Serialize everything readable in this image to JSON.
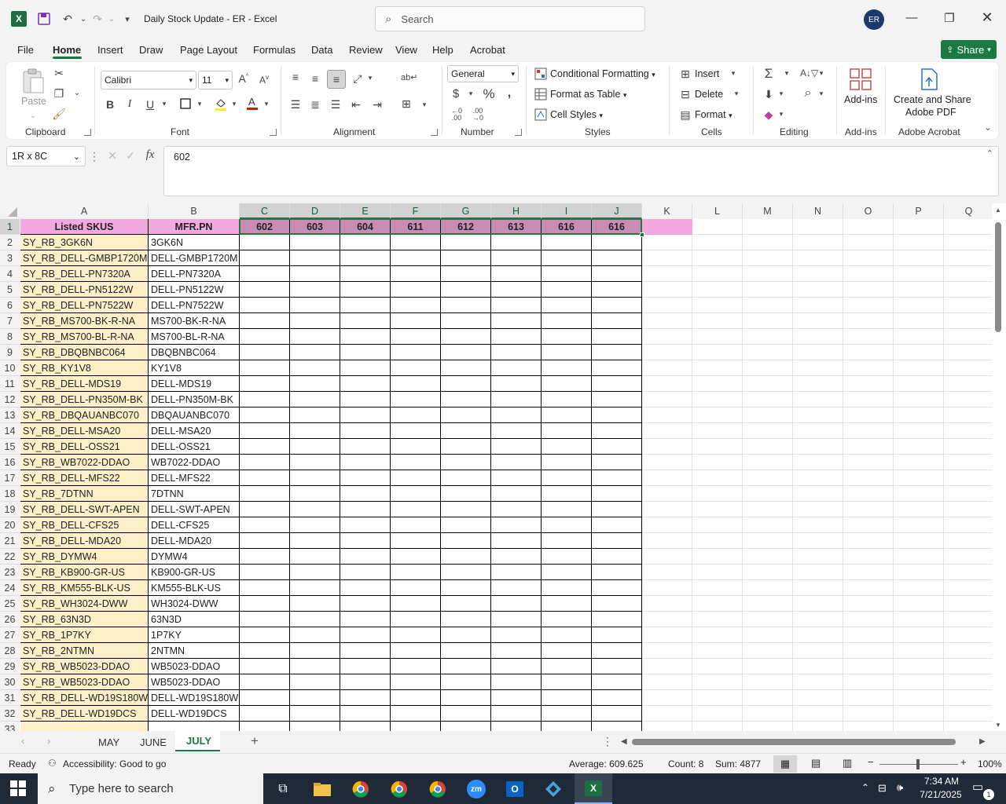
{
  "titlebar": {
    "title": "Daily Stock Update - ER  -  Excel",
    "search_placeholder": "Search",
    "avatar_initials": "ER"
  },
  "menu": {
    "items": [
      "File",
      "Home",
      "Insert",
      "Draw",
      "Page Layout",
      "Formulas",
      "Data",
      "Review",
      "View",
      "Help",
      "Acrobat"
    ],
    "share_label": "Share"
  },
  "ribbon": {
    "clipboard": {
      "paste": "Paste",
      "label": "Clipboard"
    },
    "font": {
      "name": "Calibri",
      "size": "11",
      "bold": "B",
      "italic": "I",
      "underline": "U",
      "label": "Font"
    },
    "alignment": {
      "label": "Alignment"
    },
    "number": {
      "format": "General",
      "label": "Number"
    },
    "styles": {
      "conditional": "Conditional Formatting",
      "format_table": "Format as Table",
      "cell_styles": "Cell Styles",
      "label": "Styles"
    },
    "cells": {
      "insert": "Insert",
      "delete": "Delete",
      "format": "Format",
      "label": "Cells"
    },
    "editing": {
      "label": "Editing"
    },
    "addins": {
      "button": "Add-ins",
      "label": "Add-ins"
    },
    "acrobat": {
      "button_line1": "Create and Share",
      "button_line2": "Adobe PDF",
      "label": "Adobe Acrobat"
    }
  },
  "formula_bar": {
    "name_box": "1R x 8C",
    "fx": "fx",
    "value": "602"
  },
  "columns": [
    "A",
    "B",
    "C",
    "D",
    "E",
    "F",
    "G",
    "H",
    "I",
    "J",
    "K",
    "L",
    "M",
    "N",
    "O",
    "P",
    "Q"
  ],
  "header_row": {
    "a": "Listed SKUS",
    "b": "MFR.PN",
    "values": [
      "602",
      "603",
      "604",
      "611",
      "612",
      "613",
      "616",
      "616"
    ]
  },
  "rows": [
    [
      "SY_RB_3GK6N",
      "3GK6N"
    ],
    [
      "SY_RB_DELL-GMBP1720M",
      "DELL-GMBP1720M"
    ],
    [
      "SY_RB_DELL-PN7320A",
      "DELL-PN7320A"
    ],
    [
      "SY_RB_DELL-PN5122W",
      "DELL-PN5122W"
    ],
    [
      "SY_RB_DELL-PN7522W",
      "DELL-PN7522W"
    ],
    [
      "SY_RB_MS700-BK-R-NA",
      "MS700-BK-R-NA"
    ],
    [
      "SY_RB_MS700-BL-R-NA",
      "MS700-BL-R-NA"
    ],
    [
      "SY_RB_DBQBNBC064",
      "DBQBNBC064"
    ],
    [
      "SY_RB_KY1V8",
      "KY1V8"
    ],
    [
      "SY_RB_DELL-MDS19",
      "DELL-MDS19"
    ],
    [
      "SY_RB_DELL-PN350M-BK",
      "DELL-PN350M-BK"
    ],
    [
      "SY_RB_DBQAUANBC070",
      "DBQAUANBC070"
    ],
    [
      "SY_RB_DELL-MSA20",
      "DELL-MSA20"
    ],
    [
      "SY_RB_DELL-OSS21",
      "DELL-OSS21"
    ],
    [
      "SY_RB_WB7022-DDAO",
      "WB7022-DDAO"
    ],
    [
      "SY_RB_DELL-MFS22",
      "DELL-MFS22"
    ],
    [
      "SY_RB_7DTNN",
      "7DTNN"
    ],
    [
      "SY_RB_DELL-SWT-APEN",
      "DELL-SWT-APEN"
    ],
    [
      "SY_RB_DELL-CFS25",
      "DELL-CFS25"
    ],
    [
      "SY_RB_DELL-MDA20",
      "DELL-MDA20"
    ],
    [
      "SY_RB_DYMW4",
      "DYMW4"
    ],
    [
      "SY_RB_KB900-GR-US",
      "KB900-GR-US"
    ],
    [
      "SY_RB_KM555-BLK-US",
      "KM555-BLK-US"
    ],
    [
      "SY_RB_WH3024-DWW",
      "WH3024-DWW"
    ],
    [
      "SY_RB_63N3D",
      "63N3D"
    ],
    [
      "SY_RB_1P7KY",
      "1P7KY"
    ],
    [
      "SY_RB_2NTMN",
      "2NTMN"
    ],
    [
      "SY_RB_WB5023-DDAO",
      "WB5023-DDAO"
    ],
    [
      "SY_RB_WB5023-DDAO",
      "WB5023-DDAO"
    ],
    [
      "SY_RB_DELL-WD19S180W",
      "DELL-WD19S180W"
    ],
    [
      "SY_RB_DELL-WD19DCS",
      "DELL-WD19DCS"
    ]
  ],
  "sheets": {
    "tabs": [
      "MAY",
      "JUNE",
      "JULY"
    ],
    "active": "JULY"
  },
  "status": {
    "ready": "Ready",
    "accessibility": "Accessibility: Good to go",
    "average": "Average: 609.625",
    "count": "Count: 8",
    "sum": "Sum: 4877",
    "zoom": "100%"
  },
  "taskbar": {
    "search_placeholder": "Type here to search",
    "time": "7:34 AM",
    "date": "7/21/2025",
    "notifications": "1"
  },
  "colors": {
    "header_pink": "#f3a8e0",
    "sku_fill": "#fdf0c9",
    "selected_fill": "#c98cb3",
    "excel_green": "#1b7a43"
  }
}
